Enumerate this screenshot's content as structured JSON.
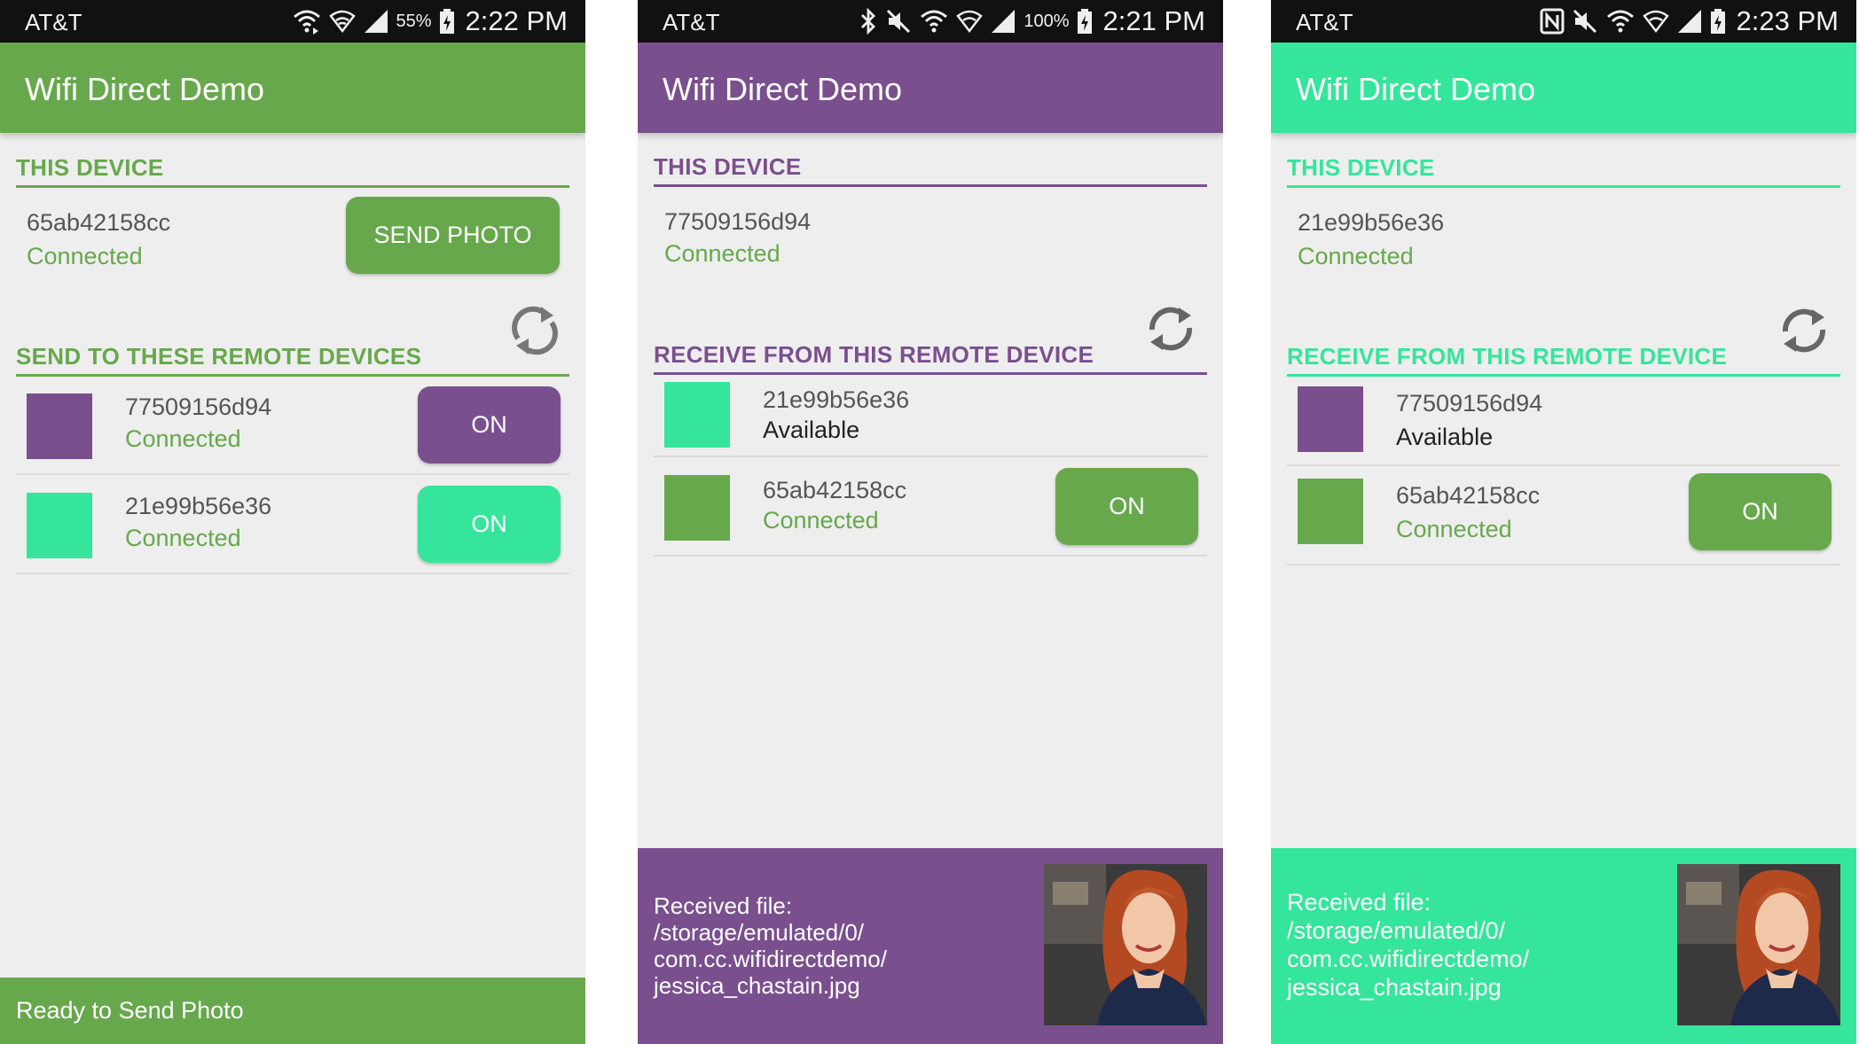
{
  "colors": {
    "purple": "#7a4f8e",
    "mint": "#35e59b",
    "green": "#67a84c",
    "statusbar": "#111111",
    "background": "#eeeeee"
  },
  "screens": [
    {
      "status": {
        "carrier": "AT&T",
        "battery": "55%",
        "time": "2:22 PM",
        "icons": [
          "cast-icon",
          "wifi-icon",
          "signal-icon",
          "battery-icon"
        ]
      },
      "app_title": "Wifi Direct Demo",
      "this_device": {
        "header": "THIS DEVICE",
        "name": "65ab42158cc",
        "status": "Connected",
        "action_label": "SEND PHOTO"
      },
      "remote": {
        "header": "SEND TO THESE REMOTE DEVICES",
        "devices": [
          {
            "name": "77509156d94",
            "status": "Connected",
            "button": "ON",
            "color": "#7a4f8e"
          },
          {
            "name": "21e99b56e36",
            "status": "Connected",
            "button": "ON",
            "color": "#35e59b"
          }
        ]
      },
      "footer": {
        "text": "Ready to Send Photo"
      }
    },
    {
      "status": {
        "carrier": "AT&T",
        "battery": "100%",
        "time": "2:21 PM",
        "icons": [
          "bluetooth-icon",
          "mute-icon",
          "cast-icon",
          "wifi-icon",
          "signal-icon",
          "battery-icon"
        ]
      },
      "app_title": "Wifi Direct Demo",
      "this_device": {
        "header": "THIS DEVICE",
        "name": "77509156d94",
        "status": "Connected"
      },
      "remote": {
        "header": "RECEIVE FROM THIS REMOTE DEVICE",
        "devices": [
          {
            "name": "21e99b56e36",
            "status": "Available",
            "color": "#35e59b"
          },
          {
            "name": "65ab42158cc",
            "status": "Connected",
            "button": "ON",
            "color": "#67a84c"
          }
        ]
      },
      "footer": {
        "lines": [
          "Received file:",
          "/storage/emulated/0/",
          "com.cc.wifidirectdemo/",
          "jessica_chastain.jpg"
        ]
      }
    },
    {
      "status": {
        "carrier": "AT&T",
        "time": "2:23 PM",
        "icons": [
          "nfc-icon",
          "mute-icon",
          "cast-icon",
          "wifi-icon",
          "signal-icon",
          "battery-icon"
        ]
      },
      "app_title": "Wifi Direct Demo",
      "this_device": {
        "header": "THIS DEVICE",
        "name": "21e99b56e36",
        "status": "Connected"
      },
      "remote": {
        "header": "RECEIVE FROM THIS REMOTE DEVICE",
        "devices": [
          {
            "name": "77509156d94",
            "status": "Available",
            "color": "#7a4f8e"
          },
          {
            "name": "65ab42158cc",
            "status": "Connected",
            "button": "ON",
            "color": "#67a84c"
          }
        ]
      },
      "footer": {
        "lines": [
          "Received file:",
          "/storage/emulated/0/",
          "com.cc.wifidirectdemo/",
          "jessica_chastain.jpg"
        ]
      }
    }
  ]
}
